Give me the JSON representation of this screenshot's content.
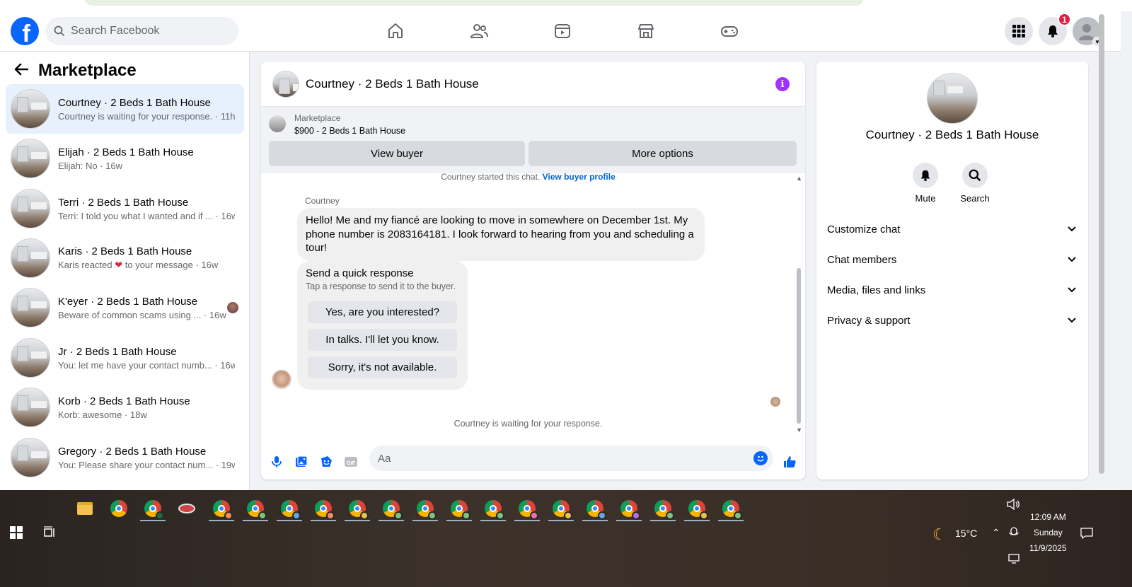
{
  "topnav": {
    "search_placeholder": "Search Facebook",
    "notification_count": "1"
  },
  "sidebar": {
    "title": "Marketplace",
    "conversations": [
      {
        "title": "Courtney · 2 Beds 1 Bath House",
        "subtitle": "Courtney is waiting for your response. · 11h",
        "active": true
      },
      {
        "title": "Elijah · 2 Beds 1 Bath House",
        "subtitle": "Elijah: No · 16w"
      },
      {
        "title": "Terri · 2 Beds 1 Bath House",
        "subtitle": "Terri: I told you what I wanted and if ... · 16w"
      },
      {
        "title": "Karis · 2 Beds 1 Bath House",
        "subtitle_pre": "Karis reacted",
        "subtitle_post": "to your message · 16w"
      },
      {
        "title": "K'eyer · 2 Beds 1 Bath House",
        "subtitle": "Beware of common scams using ...  · 16w"
      },
      {
        "title": "Jr · 2 Beds 1 Bath House",
        "subtitle": "You: let me have your contact numb... · 16w"
      },
      {
        "title": "Korb · 2 Beds 1 Bath House",
        "subtitle": "Korb: awesome · 18w"
      },
      {
        "title": "Gregory · 2 Beds 1 Bath House",
        "subtitle": "You: Please share your contact num... · 19w"
      }
    ]
  },
  "chat": {
    "title": "Courtney · 2 Beds 1 Bath House",
    "listing_source": "Marketplace",
    "listing_name": "$900 - 2 Beds 1 Bath House",
    "view_buyer": "View buyer",
    "more_options": "More options",
    "started_text": "Courtney started this chat.",
    "view_buyer_profile": "View buyer profile",
    "sender_name": "Courtney",
    "message": "Hello! Me and my fiancé are looking to move in somewhere on December 1st. My phone number is 2083164181. I look forward to hearing from you and scheduling a tour!",
    "quick_title": "Send a quick response",
    "quick_sub": "Tap a response to send it to the buyer.",
    "quick_replies": [
      "Yes, are you interested?",
      "In talks. I'll let you know.",
      "Sorry, it's not available."
    ],
    "waiting": "Courtney is waiting for your response.",
    "input_placeholder": "Aa"
  },
  "details": {
    "title": "Courtney · 2 Beds 1 Bath House",
    "mute": "Mute",
    "search": "Search",
    "sections": [
      "Customize chat",
      "Chat members",
      "Media, files and links",
      "Privacy & support"
    ]
  },
  "taskbar": {
    "weather": "15°C",
    "time": "12:09 AM",
    "day": "Sunday",
    "date": "11/9/2025",
    "profile_colors": [
      "#f28b66",
      "#7bc47f",
      "#5fa8e8",
      "#f28b66",
      "#e6c15a",
      "#7bc47f",
      "#7bc47f",
      "#7bc47f",
      "#7bc47f",
      "#e86fb5",
      "#e6c15a",
      "#5fa8e8",
      "#b06fe8",
      "#7bc47f",
      "#e6c15a",
      "#7bc47f"
    ]
  },
  "colors": {
    "brand": "#0866ff",
    "active_row": "#e7f0fd",
    "info": "#a033ff",
    "badge": "#e41e3f"
  }
}
